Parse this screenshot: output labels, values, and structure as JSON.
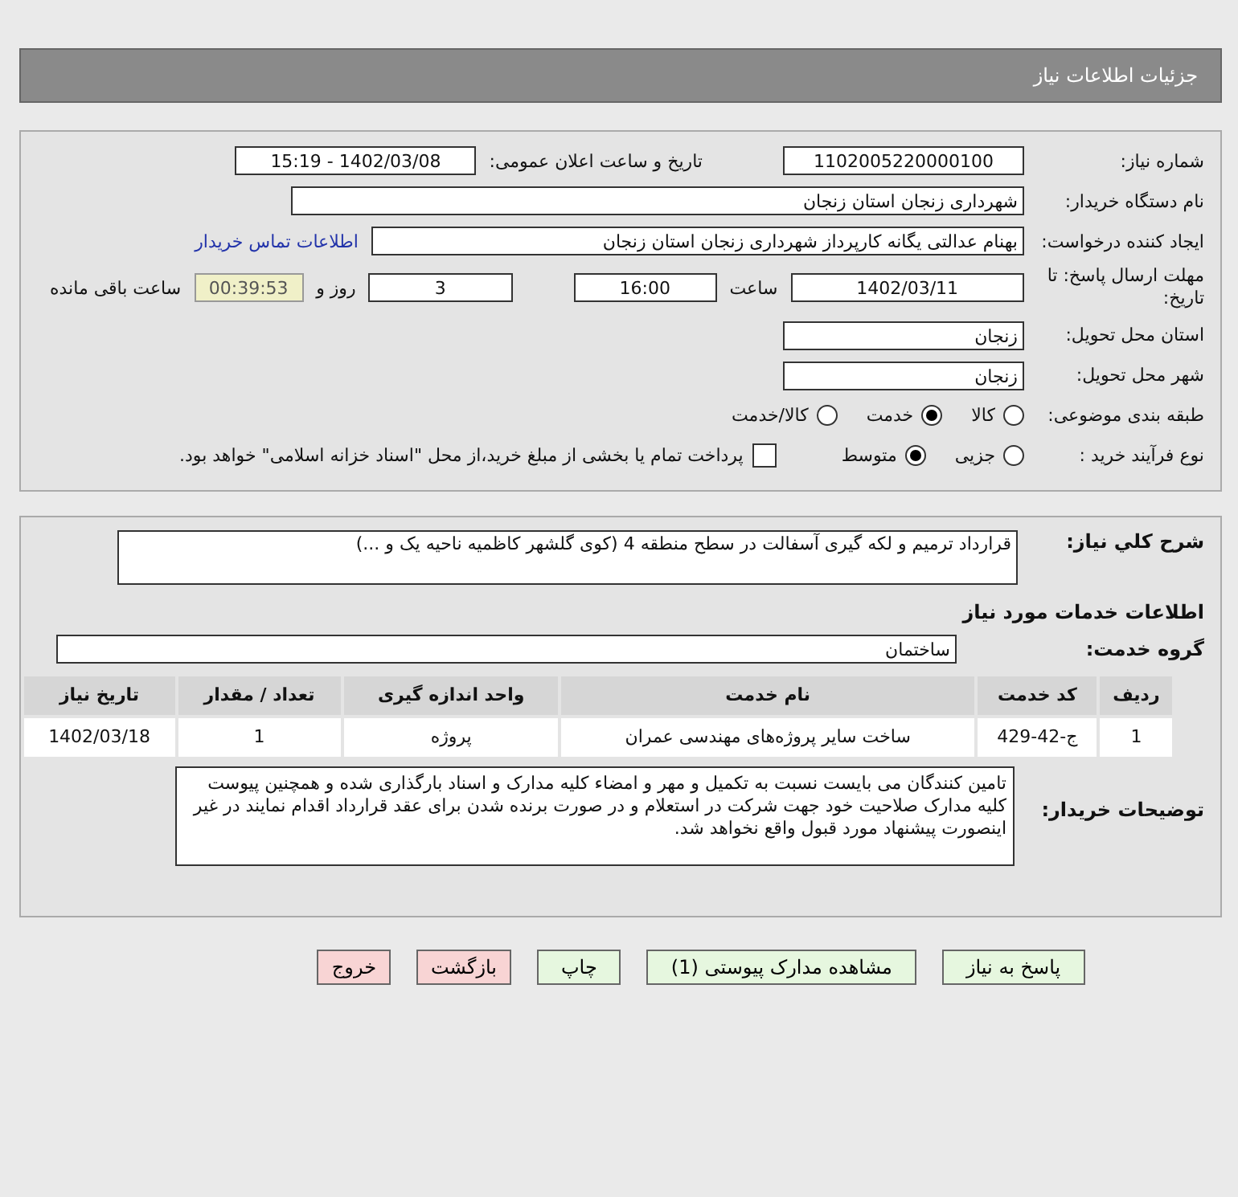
{
  "header": {
    "title": "جزئیات اطلاعات نیاز"
  },
  "need_number": {
    "label": "شماره نیاز:",
    "value": "1102005220000100"
  },
  "announce": {
    "label": "تاریخ و ساعت اعلان عمومی:",
    "value": "1402/03/08 - 15:19"
  },
  "buyer": {
    "label": "نام دستگاه خریدار:",
    "value": "شهرداری زنجان استان زنجان"
  },
  "creator": {
    "label": "ایجاد کننده درخواست:",
    "value": "بهنام عدالتی یگانه کارپرداز شهرداری زنجان استان زنجان",
    "link": "اطلاعات تماس خریدار"
  },
  "deadline": {
    "label": "مهلت ارسال پاسخ: تا تاریخ:",
    "date": "1402/03/11",
    "time_label": "ساعت",
    "time": "16:00",
    "days": "3",
    "days_label": "روز و",
    "remaining": "00:39:53",
    "remaining_label": "ساعت باقی مانده"
  },
  "province": {
    "label": "استان محل تحویل:",
    "value": "زنجان"
  },
  "city": {
    "label": "شهر محل تحویل:",
    "value": "زنجان"
  },
  "category": {
    "label": "طبقه بندی موضوعی:",
    "options": [
      {
        "label": "کالا",
        "selected": false
      },
      {
        "label": "خدمت",
        "selected": true
      },
      {
        "label": "کالا/خدمت",
        "selected": false
      }
    ]
  },
  "purchase_type": {
    "label": "نوع فرآیند خرید :",
    "options": [
      {
        "label": "جزیی",
        "selected": false
      },
      {
        "label": "متوسط",
        "selected": true
      }
    ],
    "checkbox": {
      "label": "پرداخت تمام یا بخشی از مبلغ خرید،از محل \"اسناد خزانه اسلامی\" خواهد بود.",
      "checked": false
    }
  },
  "description": {
    "label": "شرح کلي نياز:",
    "value": "قرارداد ترمیم و لکه گیری آسفالت در سطح منطقه 4 (کوی گلشهر کاظمیه ناحیه یک و ...)"
  },
  "services_title": "اطلاعات خدمات مورد نیاز",
  "service_group": {
    "label": "گروه خدمت:",
    "value": "ساختمان"
  },
  "table": {
    "columns": [
      "ردیف",
      "کد خدمت",
      "نام خدمت",
      "واحد اندازه گیری",
      "تعداد / مقدار",
      "تاریخ نیاز"
    ],
    "rows": [
      [
        "1",
        "ج-42-429",
        "ساخت سایر پروژه‌های مهندسی عمران",
        "پروژه",
        "1",
        "1402/03/18"
      ]
    ]
  },
  "buyer_notes": {
    "label": "توضیحات خریدار:",
    "value": "تامین کنندگان می بایست نسبت به تکمیل و مهر و امضاء کلیه مدارک و اسناد بارگذاری شده و همچنین پیوست کلیه مدارک صلاحیت خود جهت شرکت در استعلام و در صورت برنده شدن برای عقد قرارداد اقدام نمایند در غیر اینصورت پیشنهاد مورد قبول واقع نخواهد شد."
  },
  "buttons": [
    {
      "label": "پاسخ به نیاز",
      "kind": "normal"
    },
    {
      "label": "مشاهده مدارک پیوستی (1)",
      "kind": "normal"
    },
    {
      "label": "چاپ",
      "kind": "normal"
    },
    {
      "label": "بازگشت",
      "kind": "danger"
    },
    {
      "label": "خروج",
      "kind": "danger"
    }
  ]
}
